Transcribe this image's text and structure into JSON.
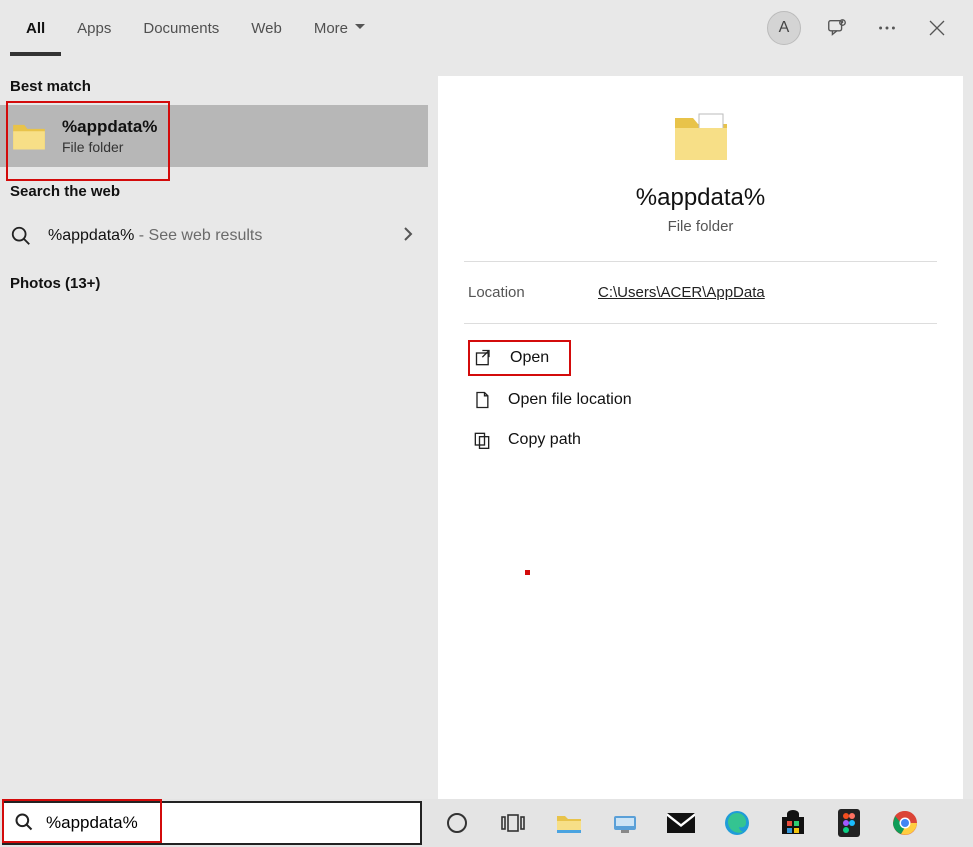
{
  "tabs": {
    "all": "All",
    "apps": "Apps",
    "documents": "Documents",
    "web": "Web",
    "more": "More"
  },
  "avatar_letter": "A",
  "left": {
    "best_match": "Best match",
    "result_title": "%appdata%",
    "result_sub": "File folder",
    "search_web_label": "Search the web",
    "web_prefix": "%appdata%",
    "web_suffix": " - See web results",
    "photos": "Photos (13+)"
  },
  "detail": {
    "title": "%appdata%",
    "sub": "File folder",
    "location_label": "Location",
    "location_value": "C:\\Users\\ACER\\AppData",
    "actions": {
      "open": "Open",
      "open_loc": "Open file location",
      "copy_path": "Copy path"
    }
  },
  "search_value": "%appdata%"
}
